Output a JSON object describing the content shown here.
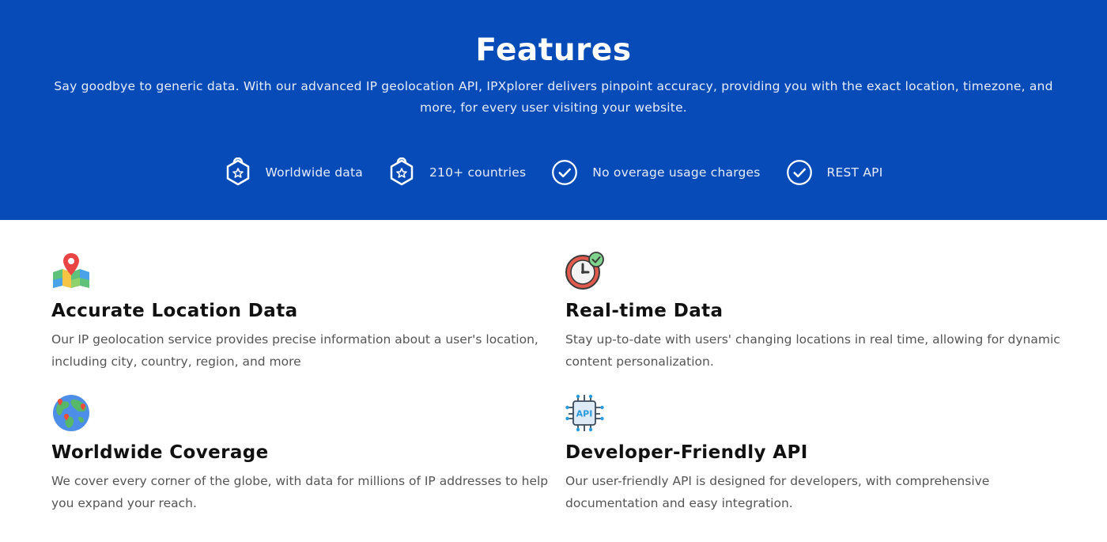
{
  "hero": {
    "title": "Features",
    "subtitle": "Say goodbye to generic data. With our advanced IP geolocation API, IPXplorer delivers pinpoint accuracy, providing you with the exact location, timezone, and more, for every user visiting your website.",
    "background": "#064bb8",
    "highlights": [
      {
        "icon": "badge-icon",
        "label": "Worldwide data"
      },
      {
        "icon": "badge-icon",
        "label": "210+ countries"
      },
      {
        "icon": "check-circle-icon",
        "label": "No overage usage charges"
      },
      {
        "icon": "check-circle-icon",
        "label": "REST API"
      }
    ]
  },
  "features": [
    {
      "icon": "map-pin-icon",
      "title": "Accurate Location Data",
      "description": "Our IP geolocation service provides precise information about a user's location, including city, country, region, and more"
    },
    {
      "icon": "clock-check-icon",
      "title": "Real-time Data",
      "description": "Stay up-to-date with users' changing locations in real time, allowing for dynamic content personalization."
    },
    {
      "icon": "globe-icon",
      "title": "Worldwide Coverage",
      "description": "We cover every corner of the globe, with data for millions of IP addresses to help you expand your reach."
    },
    {
      "icon": "api-chip-icon",
      "title": "Developer-Friendly API",
      "description": "Our user-friendly API is designed for developers, with comprehensive documentation and easy integration."
    }
  ]
}
